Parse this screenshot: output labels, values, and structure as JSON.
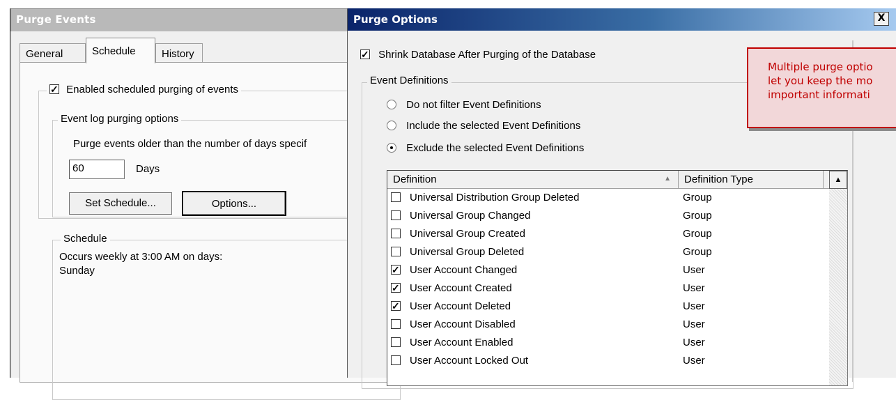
{
  "back_window": {
    "title": "Purge Events",
    "tabs": [
      "General",
      "Schedule",
      "History"
    ],
    "enable_checkbox_label": "Enabled scheduled purging of events",
    "event_log_group_caption": "Event log purging options",
    "purge_description": "Purge events older than the number of days specif",
    "days_value": "60",
    "days_unit": "Days",
    "set_schedule_button": "Set Schedule...",
    "options_button": "Options...",
    "schedule_group_caption": "Schedule",
    "schedule_line1": "Occurs weekly at 3:00 AM on days:",
    "schedule_line2": "Sunday"
  },
  "front_window": {
    "title": "Purge Options",
    "close_glyph": "X",
    "shrink_checkbox_label": "Shrink Database After Purging of the Database",
    "event_definitions_caption": "Event Definitions",
    "radio_options": [
      {
        "label": "Do not filter Event Definitions",
        "selected": false
      },
      {
        "label": "Include the selected Event Definitions",
        "selected": false
      },
      {
        "label": "Exclude the selected Event Definitions",
        "selected": true
      }
    ],
    "list": {
      "columns": [
        "Definition",
        "Definition Type"
      ],
      "sort_glyph": "▲",
      "rows": [
        {
          "definition": "Universal Distribution Group Deleted",
          "type": "Group",
          "checked": false
        },
        {
          "definition": "Universal Group Changed",
          "type": "Group",
          "checked": false
        },
        {
          "definition": "Universal Group Created",
          "type": "Group",
          "checked": false
        },
        {
          "definition": "Universal Group Deleted",
          "type": "Group",
          "checked": false
        },
        {
          "definition": "User Account Changed",
          "type": "User",
          "checked": true
        },
        {
          "definition": "User Account Created",
          "type": "User",
          "checked": true
        },
        {
          "definition": "User Account Deleted",
          "type": "User",
          "checked": true
        },
        {
          "definition": "User Account Disabled",
          "type": "User",
          "checked": false
        },
        {
          "definition": "User Account Enabled",
          "type": "User",
          "checked": false
        },
        {
          "definition": "User Account Locked Out",
          "type": "User",
          "checked": false
        }
      ]
    }
  },
  "callout": {
    "line1": "Multiple purge optio",
    "line2": "let you keep the mo",
    "line3": "important informati"
  }
}
